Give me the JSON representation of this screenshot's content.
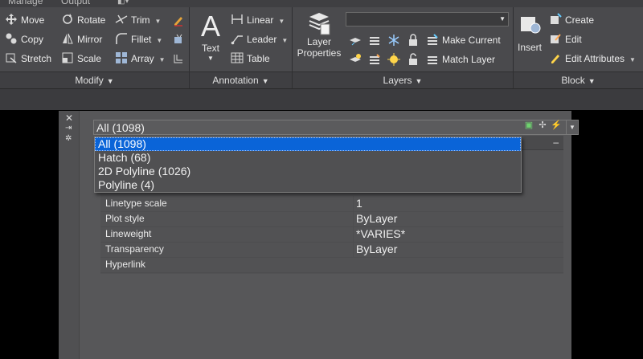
{
  "top_tabs": [
    "Manage",
    "Output"
  ],
  "modify": {
    "footer": "Modify",
    "tools": {
      "move": "Move",
      "rotate": "Rotate",
      "trim": "Trim",
      "copy": "Copy",
      "mirror": "Mirror",
      "fillet": "Fillet",
      "stretch": "Stretch",
      "scale": "Scale",
      "array": "Array"
    }
  },
  "annotation": {
    "footer": "Annotation",
    "text": "Text",
    "linear": "Linear",
    "leader": "Leader",
    "table": "Table"
  },
  "layers": {
    "footer": "Layers",
    "layer_properties_line1": "Layer",
    "layer_properties_line2": "Properties",
    "layer_combo_value": "",
    "make_current": "Make Current",
    "match_layer": "Match Layer"
  },
  "block": {
    "footer": "Block",
    "insert": "Insert",
    "create": "Create",
    "edit": "Edit",
    "edit_attributes": "Edit Attributes"
  },
  "palette": {
    "selection": "All (1098)",
    "dropdown_options": [
      "All (1098)",
      "Hatch (68)",
      "2D Polyline (1026)",
      "Polyline (4)"
    ],
    "rows": [
      {
        "label": "Linetype scale",
        "value": "1"
      },
      {
        "label": "Plot style",
        "value": "ByLayer"
      },
      {
        "label": "Lineweight",
        "value": "*VARIES*"
      },
      {
        "label": "Transparency",
        "value": "ByLayer"
      },
      {
        "label": "Hyperlink",
        "value": ""
      }
    ]
  },
  "colors": {
    "accent": "#0a64d8",
    "ribbon": "#4a4a4d",
    "palette": "#575759"
  }
}
